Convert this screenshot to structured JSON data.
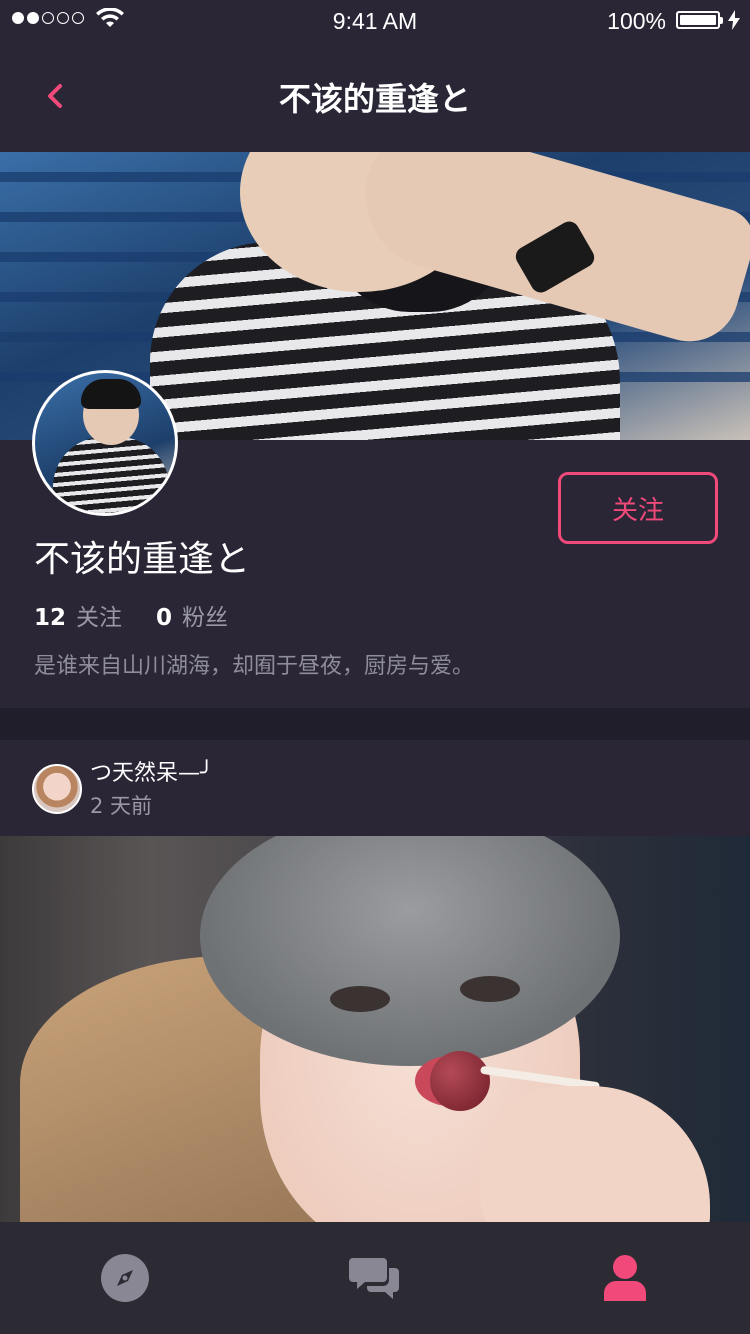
{
  "status_bar": {
    "time": "9:41 AM",
    "battery": "100%",
    "signal_icon": "signal-dots-icon",
    "wifi_icon": "wifi-icon",
    "battery_icon": "battery-icon",
    "charging_icon": "charging-bolt-icon"
  },
  "nav": {
    "title": "不该的重逢と",
    "back_icon": "chevron-left-icon"
  },
  "profile": {
    "name": "不该的重逢と",
    "follow_label": "关注",
    "following_count": "12",
    "following_label": "关注",
    "followers_count": "0",
    "followers_label": "粉丝",
    "bio": "是谁来自山川湖海，却囿于昼夜，厨房与爱。"
  },
  "post": {
    "author": "つ天然呆—╯",
    "time": "2 天前"
  },
  "tabs": [
    {
      "icon": "compass-icon",
      "active": false
    },
    {
      "icon": "chat-bubbles-icon",
      "active": false
    },
    {
      "icon": "user-icon",
      "active": true
    }
  ],
  "colors": {
    "accent": "#f0497a",
    "background": "#2a2636",
    "separator": "#211e2b",
    "tab_bar": "#2c2a33",
    "inactive_icon": "#8a8794"
  }
}
